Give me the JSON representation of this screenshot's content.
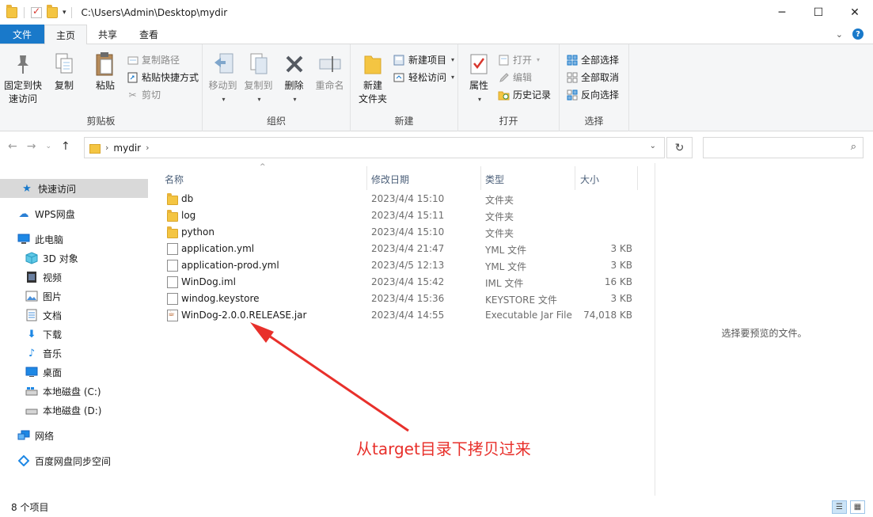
{
  "window": {
    "path": "C:\\Users\\Admin\\Desktop\\mydir",
    "controls": {
      "minimize": "─",
      "maximize": "☐",
      "close": "✕"
    }
  },
  "tabs": [
    {
      "label": "文件"
    },
    {
      "label": "主页"
    },
    {
      "label": "共享"
    },
    {
      "label": "查看"
    }
  ],
  "ribbon": {
    "clipboard": {
      "pin": "固定到快\n速访问",
      "copy": "复制",
      "paste": "粘贴",
      "copy_path": "复制路径",
      "paste_shortcut": "粘贴快捷方式",
      "cut": "剪切",
      "label": "剪贴板"
    },
    "organize": {
      "move_to": "移动到",
      "copy_to": "复制到",
      "delete": "删除",
      "rename": "重命名",
      "label": "组织"
    },
    "new": {
      "new_folder": "新建\n文件夹",
      "new_item": "新建项目",
      "easy_access": "轻松访问",
      "label": "新建"
    },
    "open": {
      "properties": "属性",
      "open": "打开",
      "edit": "编辑",
      "history": "历史记录",
      "label": "打开"
    },
    "select": {
      "select_all": "全部选择",
      "select_none": "全部取消",
      "invert": "反向选择",
      "label": "选择"
    }
  },
  "address": {
    "folder": "mydir"
  },
  "sidebar": {
    "items": [
      {
        "label": "快速访问",
        "icon": "star-icon",
        "selected": true
      },
      {
        "label": "WPS网盘",
        "icon": "cloud-icon"
      },
      {
        "label": "此电脑",
        "icon": "computer-icon"
      },
      {
        "label": "3D 对象",
        "icon": "cube-icon"
      },
      {
        "label": "视频",
        "icon": "video-icon"
      },
      {
        "label": "图片",
        "icon": "picture-icon"
      },
      {
        "label": "文档",
        "icon": "document-icon"
      },
      {
        "label": "下载",
        "icon": "download-icon"
      },
      {
        "label": "音乐",
        "icon": "music-icon"
      },
      {
        "label": "桌面",
        "icon": "desktop-icon"
      },
      {
        "label": "本地磁盘 (C:)",
        "icon": "drive-icon"
      },
      {
        "label": "本地磁盘 (D:)",
        "icon": "drive-icon"
      },
      {
        "label": "网络",
        "icon": "network-icon"
      },
      {
        "label": "百度网盘同步空间",
        "icon": "baidu-sync-icon"
      }
    ]
  },
  "columns": {
    "name": "名称",
    "date": "修改日期",
    "type": "类型",
    "size": "大小"
  },
  "files": [
    {
      "name": "db",
      "date": "2023/4/4 15:10",
      "type": "文件夹",
      "size": "",
      "icon": "folder-icon"
    },
    {
      "name": "log",
      "date": "2023/4/4 15:11",
      "type": "文件夹",
      "size": "",
      "icon": "folder-icon"
    },
    {
      "name": "python",
      "date": "2023/4/4 15:10",
      "type": "文件夹",
      "size": "",
      "icon": "folder-icon"
    },
    {
      "name": "application.yml",
      "date": "2023/4/4 21:47",
      "type": "YML 文件",
      "size": "3 KB",
      "icon": "file-icon"
    },
    {
      "name": "application-prod.yml",
      "date": "2023/4/5 12:13",
      "type": "YML 文件",
      "size": "3 KB",
      "icon": "file-icon"
    },
    {
      "name": "WinDog.iml",
      "date": "2023/4/4 15:42",
      "type": "IML 文件",
      "size": "16 KB",
      "icon": "file-icon"
    },
    {
      "name": "windog.keystore",
      "date": "2023/4/4 15:36",
      "type": "KEYSTORE 文件",
      "size": "3 KB",
      "icon": "file-icon"
    },
    {
      "name": "WinDog-2.0.0.RELEASE.jar",
      "date": "2023/4/4 14:55",
      "type": "Executable Jar File",
      "size": "74,018 KB",
      "icon": "jar-icon"
    }
  ],
  "preview": {
    "text": "选择要预览的文件。"
  },
  "annotation": {
    "text": "从target目录下拷贝过来",
    "color": "#e8302b"
  },
  "status": {
    "count": "8 个项目"
  }
}
